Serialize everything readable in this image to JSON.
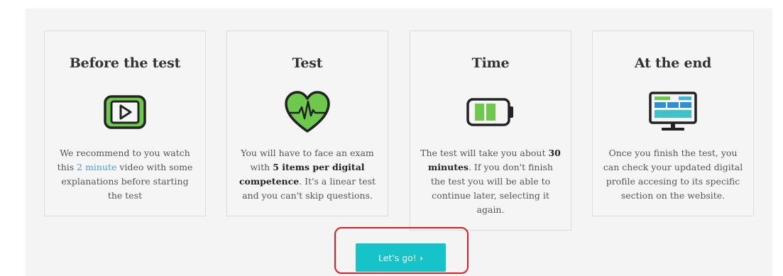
{
  "cards": [
    {
      "title": "Before the test",
      "icon": "play-video-icon",
      "text_1": "We recommend to you watch this ",
      "link": "2 minute",
      "text_2": " video with some explanations before starting the test"
    },
    {
      "title": "Test",
      "icon": "heart-pulse-icon",
      "text_1": "You will have to face an exam with ",
      "bold": "5 items per digital competence",
      "text_2": ". It's a linear test and you can't skip questions."
    },
    {
      "title": "Time",
      "icon": "battery-icon",
      "text_1": "The test will take you about ",
      "bold": "30 minutes",
      "text_2": ". If you don't finish the test you will be able to continue later, selecting it again."
    },
    {
      "title": "At the end",
      "icon": "monitor-profile-icon",
      "text": "Once you finish the test, you can check your updated digital profile accesing to its specific section on the website."
    }
  ],
  "cta": {
    "label": "Let's go!",
    "arrow": "›"
  },
  "colors": {
    "accent": "#15c3c8",
    "icon_green": "#6dc94b",
    "link": "#4a9fd8",
    "highlight": "#e02020"
  }
}
